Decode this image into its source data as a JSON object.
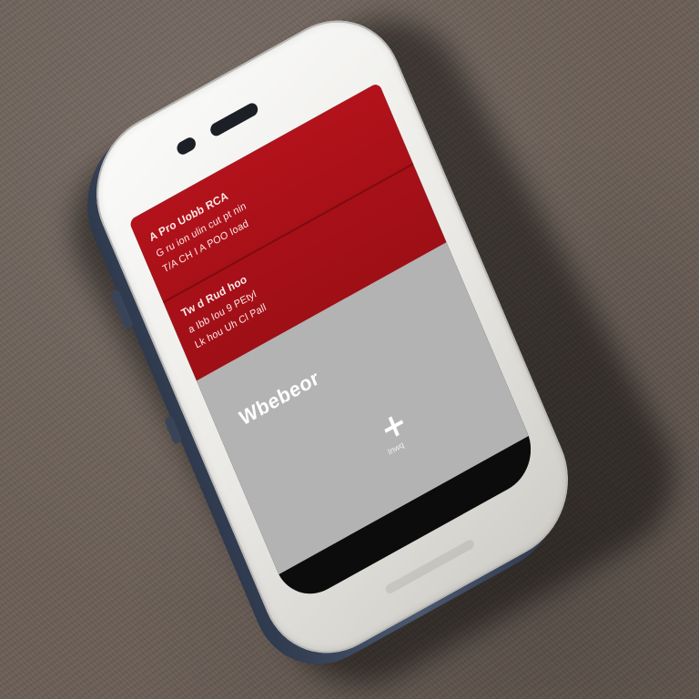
{
  "phone": {
    "banner": {
      "line1": "A Pro Uobb RCA",
      "line2": "G ru ion ulin cut pt nin",
      "line3": "T/A CH I A POO Ioad",
      "line4": "Tw d Rud hoo",
      "line5": "a Ibb Iou 9 PEtyl",
      "line6": "Lk hou Uh Cl Pall"
    },
    "title": "Wbebeor",
    "plus_label": "Inwq"
  },
  "colors": {
    "banner": "#b3121b",
    "screen_background": "#b3b3b3",
    "phone_front": "#f2f1ee",
    "phone_side": "#3f4a60",
    "surface": "#6b5f57"
  }
}
